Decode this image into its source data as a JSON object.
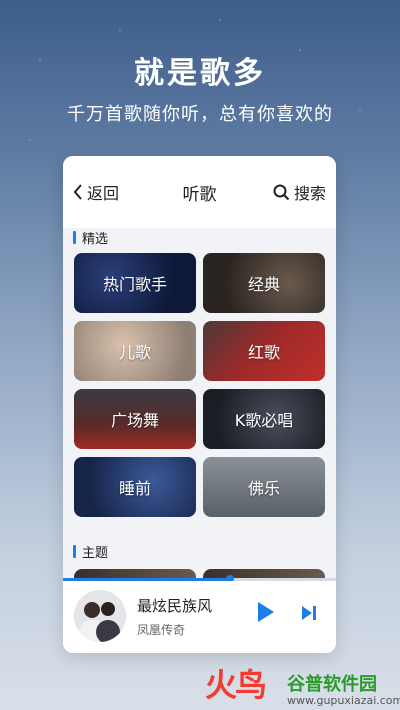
{
  "hero": {
    "title": "就是歌多",
    "subtitle": "千万首歌随你听，总有你喜欢的"
  },
  "topbar": {
    "back_icon": "chevron-left-icon",
    "back_label": "返回",
    "title": "听歌",
    "search_icon": "search-icon",
    "search_label": "搜索"
  },
  "sections": {
    "featured": "精选",
    "themes": "主题"
  },
  "tiles": [
    {
      "label": "热门歌手"
    },
    {
      "label": "经典"
    },
    {
      "label": "儿歌"
    },
    {
      "label": "红歌"
    },
    {
      "label": "广场舞"
    },
    {
      "label": "K歌必唱"
    },
    {
      "label": "睡前"
    },
    {
      "label": "佛乐"
    }
  ],
  "player": {
    "song": "最炫民族风",
    "artist": "凤凰传奇",
    "progress": 0.61,
    "play_icon": "play-icon",
    "next_icon": "skip-next-icon"
  },
  "watermark": {
    "logo_text": "火鸟",
    "name": "谷普软件园",
    "url": "www.gupuxiazai.com"
  },
  "colors": {
    "accent": "#1e7ee8",
    "watermark_red": "#f23c32",
    "watermark_green": "#2a9a2a"
  }
}
